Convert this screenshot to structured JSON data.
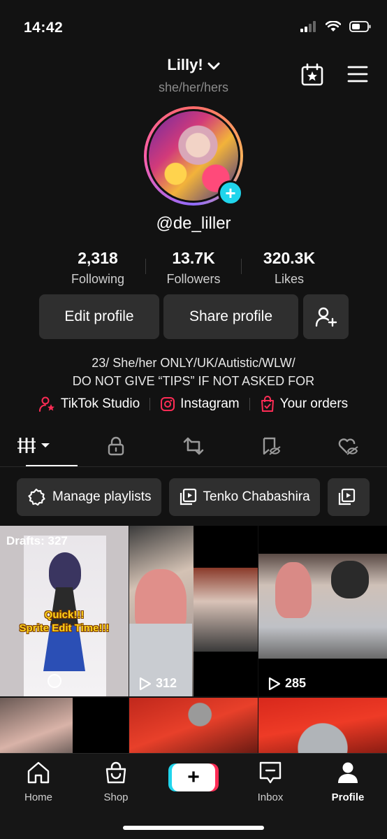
{
  "status_bar": {
    "time": "14:42"
  },
  "header": {
    "display_name": "Lilly!",
    "pronouns": "she/her/hers",
    "handle": "@de_liller"
  },
  "stats": {
    "following_count": "2,318",
    "following_label": "Following",
    "followers_count": "13.7K",
    "followers_label": "Followers",
    "likes_count": "320.3K",
    "likes_label": "Likes"
  },
  "actions": {
    "edit_label": "Edit profile",
    "share_label": "Share profile"
  },
  "bio": {
    "line1": "23/ She/her ONLY/UK/Autistic/WLW/",
    "line2": "DO NOT GIVE “TIPS” IF NOT ASKED FOR"
  },
  "links": {
    "studio": "TikTok Studio",
    "instagram": "Instagram",
    "orders": "Your orders"
  },
  "playlists": {
    "manage_label": "Manage playlists",
    "playlist1": "Tenko Chabashira"
  },
  "grid": {
    "drafts_label": "Drafts: 327",
    "draft_text_1": "Quick!!!",
    "draft_text_2": "Sprite Edit Time!!!",
    "video2_views": "312",
    "video3_views": "285"
  },
  "nav": {
    "home": "Home",
    "shop": "Shop",
    "inbox": "Inbox",
    "profile": "Profile"
  },
  "colors": {
    "background": "#121212",
    "button": "#2f2f2f",
    "accent_cyan": "#20d5ec",
    "accent_red": "#fe2c55"
  }
}
